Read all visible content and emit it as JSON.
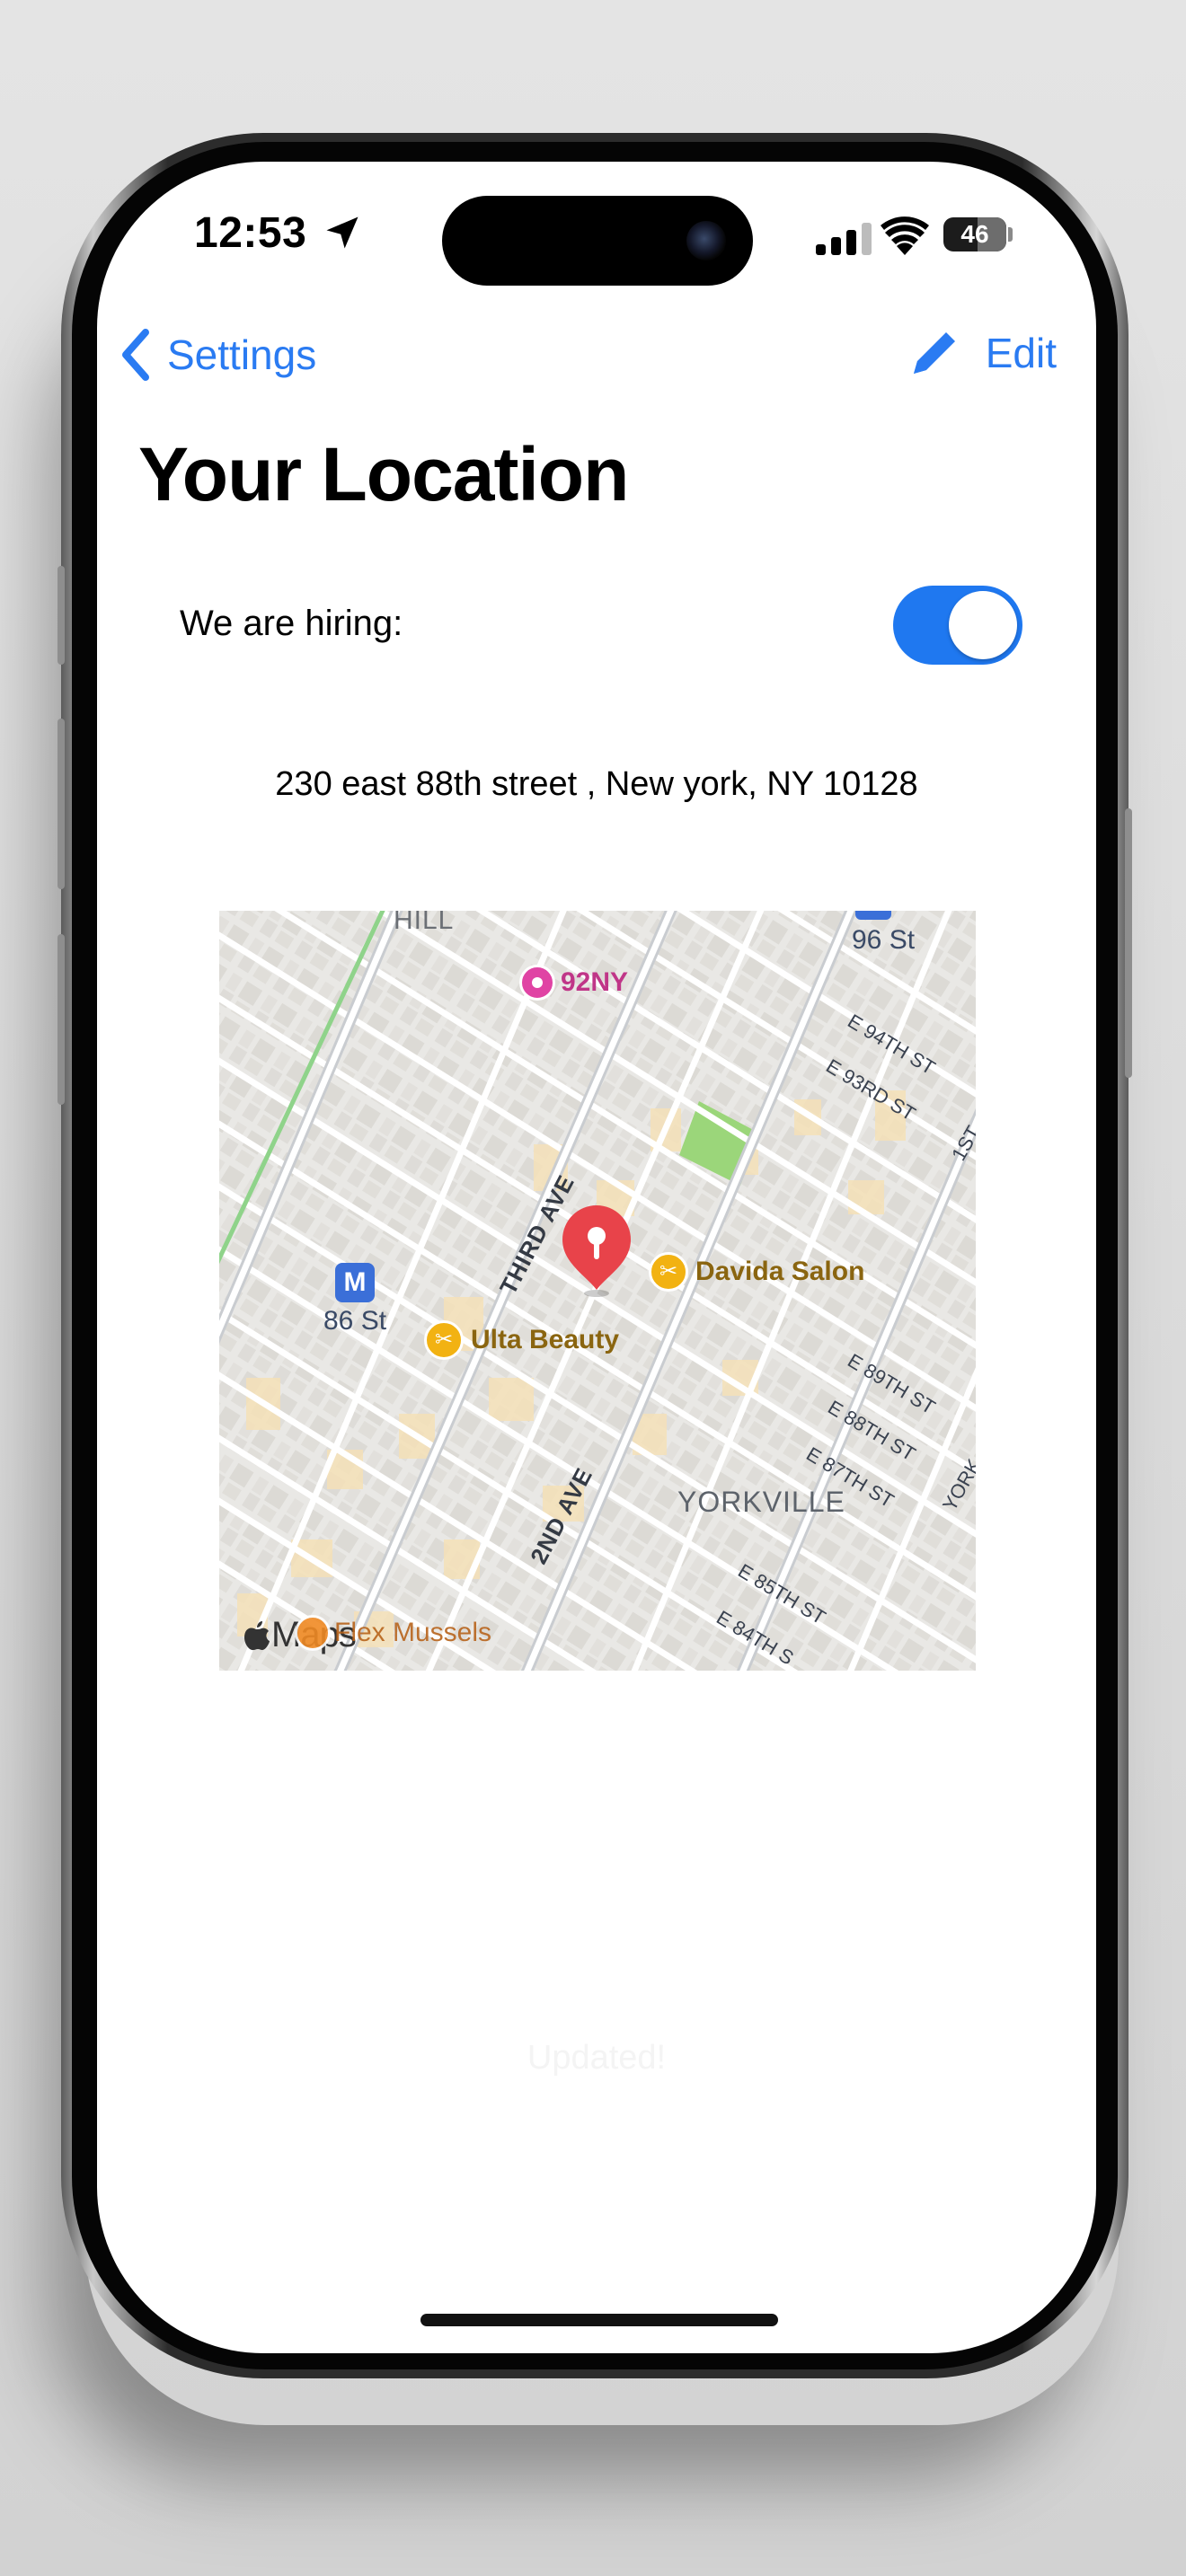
{
  "status_bar": {
    "time": "12:53",
    "battery_level": "46"
  },
  "nav": {
    "back_label": "Settings",
    "edit_label": "Edit"
  },
  "page": {
    "title": "Your Location",
    "hiring_label": "We are hiring:",
    "hiring_enabled": true,
    "address": "230 east 88th street , New york, NY 10128",
    "updated_text": "Updated!"
  },
  "map": {
    "neighborhood_top": "HILL",
    "neighborhood": "YORKVILLE",
    "station_north": "96 St",
    "station_west": "86 St",
    "subway_letter": "M",
    "pois": {
      "ny92": "92NY",
      "davida": "Davida Salon",
      "ulta": "Ulta Beauty",
      "flex": "Flex Mussels"
    },
    "streets": {
      "third_ave": "THIRD AVE",
      "second_ave": "2ND AVE",
      "first_ave": "1ST",
      "york": "YORK",
      "e94": "E 94TH ST",
      "e93": "E 93RD ST",
      "e89": "E 89TH ST",
      "e88": "E 88TH ST",
      "e87": "E 87TH ST",
      "e85": "E 85TH ST",
      "e84": "E 84TH S"
    },
    "attribution": "Maps",
    "accent_colors": {
      "pin": "#e8434a",
      "poi_pink": "#e043a4",
      "poi_yellow": "#f2b212",
      "park": "#9bd67a",
      "subway": "#3b6fd8"
    }
  }
}
